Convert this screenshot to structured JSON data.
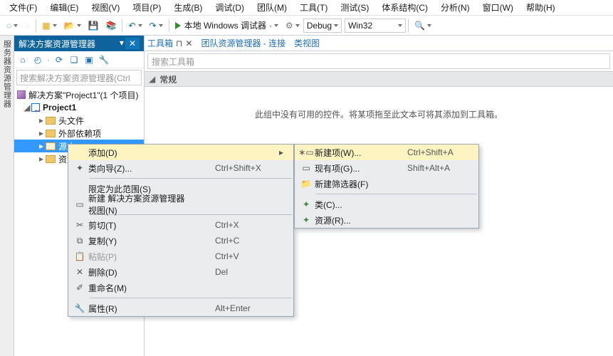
{
  "menu": [
    "文件(F)",
    "编辑(E)",
    "视图(V)",
    "项目(P)",
    "生成(B)",
    "调试(D)",
    "团队(M)",
    "工具(T)",
    "测试(S)",
    "体系结构(C)",
    "分析(N)",
    "窗口(W)",
    "帮助(H)"
  ],
  "toolbar": {
    "start_label": "本地 Windows 调试器",
    "config": "Debug",
    "platform": "Win32"
  },
  "left_edge": "服务器资源管理器",
  "panel": {
    "title": "解决方案资源管理器",
    "search_placeholder": "搜索解决方案资源管理器(Ctrl",
    "solution": "解决方案\"Project1\"(1 个项目)",
    "project": "Project1",
    "nodes": {
      "headers": "头文件",
      "extern": "外部依赖项",
      "src": "源文",
      "res": "资源"
    }
  },
  "tabs": {
    "toolbox": "工具箱",
    "team": "团队资源管理器 - 连接",
    "classview": "类视图"
  },
  "toolbox": {
    "search": "搜索工具箱",
    "section": "常规",
    "empty": "此组中没有可用的控件。将某项拖至此文本可将其添加到工具箱。"
  },
  "ctx1": {
    "add": "添加(D)",
    "wizard": "类向导(Z)...",
    "wizard_sc": "Ctrl+Shift+X",
    "scope": "限定为此范围(S)",
    "newview": "新建 解决方案资源管理器 视图(N)",
    "cut": "剪切(T)",
    "cut_sc": "Ctrl+X",
    "copy": "复制(Y)",
    "copy_sc": "Ctrl+C",
    "paste": "粘贴(P)",
    "paste_sc": "Ctrl+V",
    "delete": "删除(D)",
    "delete_sc": "Del",
    "rename": "重命名(M)",
    "props": "属性(R)",
    "props_sc": "Alt+Enter"
  },
  "ctx2": {
    "newitem": "新建项(W)...",
    "newitem_sc": "Ctrl+Shift+A",
    "existing": "现有项(G)...",
    "existing_sc": "Shift+Alt+A",
    "filter": "新建筛选器(F)",
    "class": "类(C)...",
    "resource": "资源(R)..."
  }
}
